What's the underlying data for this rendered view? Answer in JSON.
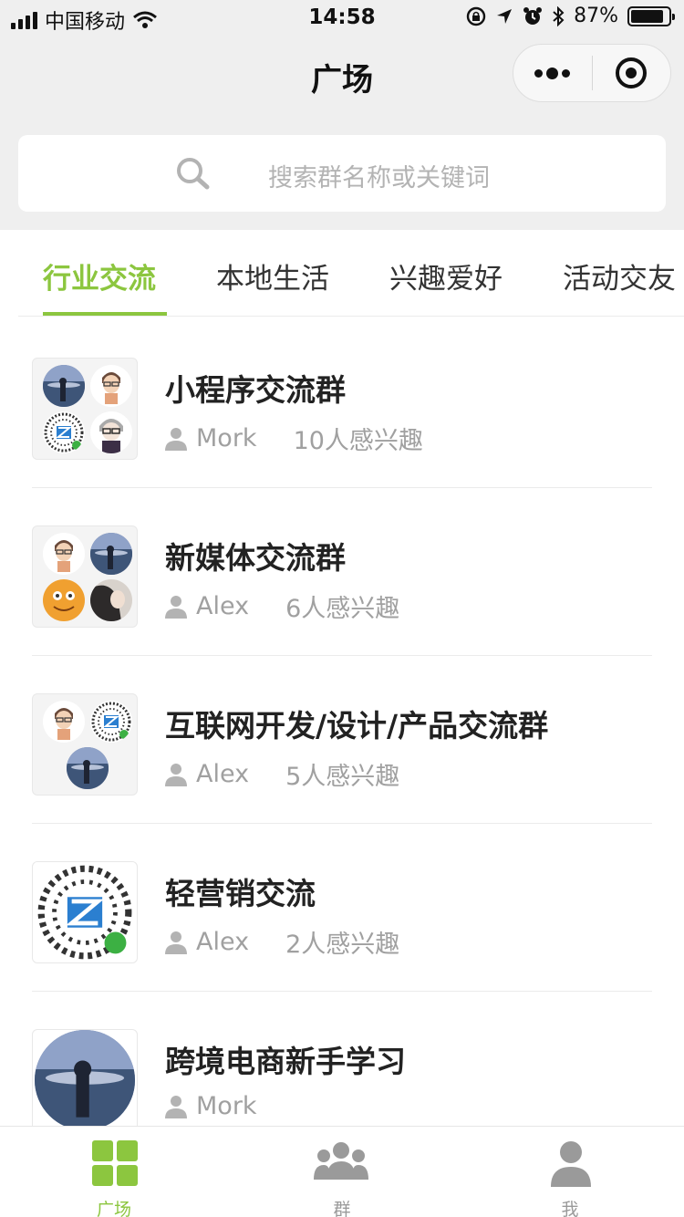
{
  "status_bar": {
    "carrier": "中国移动",
    "time": "14:58",
    "battery": "87%",
    "battery_level": 0.87
  },
  "nav": {
    "title": "广场",
    "more_icon": "more-dots-icon",
    "close_icon": "target-icon"
  },
  "search": {
    "placeholder": "搜索群名称或关键词",
    "icon": "search-icon"
  },
  "tabs": [
    {
      "label": "行业交流",
      "active": true
    },
    {
      "label": "本地生活",
      "active": false
    },
    {
      "label": "兴趣爱好",
      "active": false
    },
    {
      "label": "活动交友",
      "active": false
    }
  ],
  "groups": [
    {
      "title": "小程序交流群",
      "owner": "Mork",
      "interest": "10人感兴趣"
    },
    {
      "title": "新媒体交流群",
      "owner": "Alex",
      "interest": "6人感兴趣"
    },
    {
      "title": "互联网开发/设计/产品交流群",
      "owner": "Alex",
      "interest": "5人感兴趣"
    },
    {
      "title": "轻营销交流",
      "owner": "Alex",
      "interest": "2人感兴趣"
    },
    {
      "title": "跨境电商新手学习",
      "owner": "Mork",
      "interest": ""
    }
  ],
  "tabbar": [
    {
      "label": "广场",
      "icon": "grid-icon",
      "active": true
    },
    {
      "label": "群",
      "icon": "group-icon",
      "active": false
    },
    {
      "label": "我",
      "icon": "user-icon",
      "active": false
    }
  ],
  "colors": {
    "accent": "#8cc63f",
    "nav_bg": "#efefef",
    "inactive": "#9a9a9a"
  }
}
